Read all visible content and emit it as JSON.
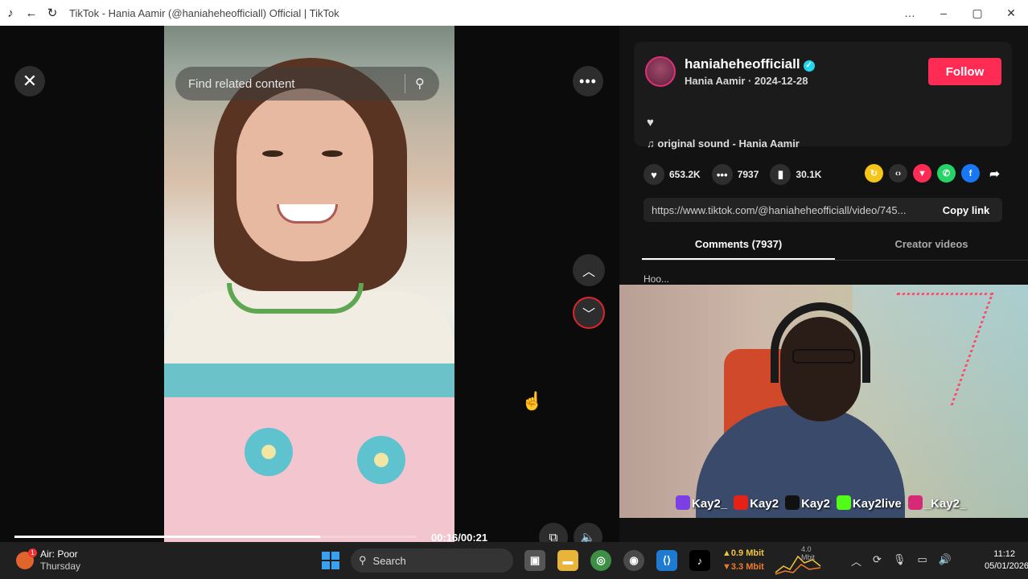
{
  "window": {
    "title": "TikTok - Hania Aamir (@haniaheheofficiall) Official | TikTok",
    "controls": [
      "…",
      "–",
      "▢",
      "✕"
    ]
  },
  "player": {
    "search_placeholder": "Find related content",
    "time": "00:16/00:21",
    "progress": 0.76
  },
  "post": {
    "username": "haniaheheofficiall",
    "display_name": "Hania Aamir",
    "date": "2024-12-28",
    "subline": "Hania Aamir · 2024-12-28",
    "follow_label": "Follow",
    "sound": "original sound - Hania Aamir",
    "likes": "653.2K",
    "comments": "7937",
    "saves": "30.1K",
    "link": "https://www.tiktok.com/@haniaheheofficiall/video/745...",
    "copy_label": "Copy link"
  },
  "tabs": [
    {
      "label": "Comments (7937)",
      "active": true
    },
    {
      "label": "Creator videos",
      "active": false
    }
  ],
  "comment_peek": "Hoo...",
  "overlay_socials": [
    {
      "label": "Kay2_",
      "color": "#7b3fe4"
    },
    {
      "label": "Kay2",
      "color": "#e62117"
    },
    {
      "label": "Kay2",
      "color": "#111111"
    },
    {
      "label": "Kay2live",
      "color": "#53fc18"
    },
    {
      "label": "_Kay2_",
      "color": "#d62976"
    }
  ],
  "taskbar": {
    "weather_title": "Air: Poor",
    "weather_sub": "Thursday",
    "weather_badge": "1",
    "search_label": "Search",
    "net_up": "▲0.9 Mbit",
    "net_down": "▼3.3 Mbit",
    "net_scale": "4.0 Mbit",
    "time": "11:12",
    "date": "05/01/2026"
  },
  "colors": {
    "follow": "#fe2c55",
    "verified": "#20d5ec",
    "accent_red": "#e0242c"
  }
}
